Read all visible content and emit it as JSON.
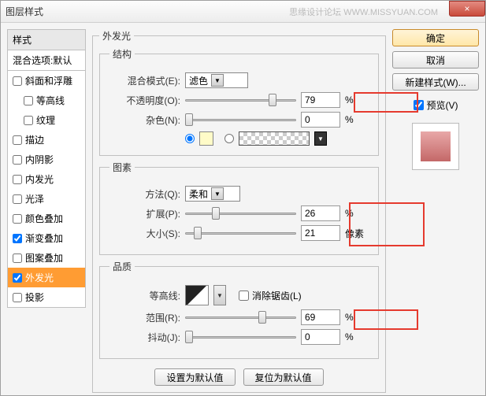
{
  "window": {
    "title": "图层样式",
    "watermark": "思缘设计论坛  WWW.MISSYUAN.COM"
  },
  "close_label": "×",
  "left": {
    "header": "样式",
    "sub": "混合选项:默认",
    "items": [
      {
        "label": "斜面和浮雕",
        "checked": false,
        "indent": false
      },
      {
        "label": "等高线",
        "checked": false,
        "indent": true
      },
      {
        "label": "纹理",
        "checked": false,
        "indent": true
      },
      {
        "label": "描边",
        "checked": false,
        "indent": false
      },
      {
        "label": "内阴影",
        "checked": false,
        "indent": false
      },
      {
        "label": "内发光",
        "checked": false,
        "indent": false
      },
      {
        "label": "光泽",
        "checked": false,
        "indent": false
      },
      {
        "label": "颜色叠加",
        "checked": false,
        "indent": false
      },
      {
        "label": "渐变叠加",
        "checked": true,
        "indent": false
      },
      {
        "label": "图案叠加",
        "checked": false,
        "indent": false
      },
      {
        "label": "外发光",
        "checked": true,
        "indent": false,
        "selected": true
      },
      {
        "label": "投影",
        "checked": false,
        "indent": false
      }
    ]
  },
  "outer_title": "外发光",
  "structure": {
    "legend": "结构",
    "blend_label": "混合模式(E):",
    "blend_value": "滤色",
    "opacity_label": "不透明度(O):",
    "opacity_value": "79",
    "opacity_unit": "%",
    "noise_label": "杂色(N):",
    "noise_value": "0",
    "noise_unit": "%"
  },
  "element": {
    "legend": "图素",
    "method_label": "方法(Q):",
    "method_value": "柔和",
    "spread_label": "扩展(P):",
    "spread_value": "26",
    "spread_unit": "%",
    "size_label": "大小(S):",
    "size_value": "21",
    "size_unit": "像素"
  },
  "quality": {
    "legend": "品质",
    "contour_label": "等高线:",
    "antialias_label": "消除锯齿(L)",
    "range_label": "范围(R):",
    "range_value": "69",
    "range_unit": "%",
    "jitter_label": "抖动(J):",
    "jitter_value": "0",
    "jitter_unit": "%"
  },
  "buttons": {
    "default_set": "设置为默认值",
    "default_reset": "复位为默认值",
    "ok": "确定",
    "cancel": "取消",
    "new_style": "新建样式(W)...",
    "preview": "预览(V)"
  }
}
